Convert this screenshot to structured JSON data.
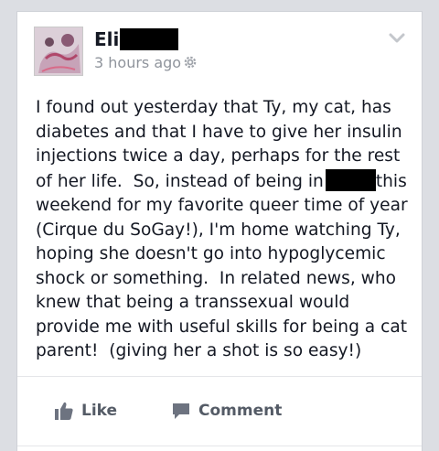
{
  "post": {
    "author": "Eli",
    "timestamp": "3 hours ago",
    "privacy_icon": "gear-icon",
    "menu_icon": "chevron-down-icon",
    "body_lines": [
      "I found out yesterday that Ty, my cat, has",
      "diabetes and that I have to give her insulin",
      "injections twice a day, perhaps for the rest",
      "of her life.  So, instead of being in",
      "this",
      "weekend for my favorite queer time of year",
      "(Cirque du SoGay!), I'm home watching Ty,",
      "hoping she doesn't go into hypoglycemic",
      "shock or something.  In related news, who",
      "knew that being a transsexual would",
      "provide me with useful skills for being a cat",
      "parent!  (giving her a shot is so easy!)"
    ]
  },
  "actions": {
    "like_label": "Like",
    "like_icon": "thumbs-up-icon",
    "comment_label": "Comment",
    "comment_icon": "speech-bubble-icon"
  },
  "colors": {
    "page_bg": "#dcdee3",
    "card_bg": "#ffffff",
    "text": "#141823",
    "meta": "#8f949c",
    "action": "#545b66"
  }
}
